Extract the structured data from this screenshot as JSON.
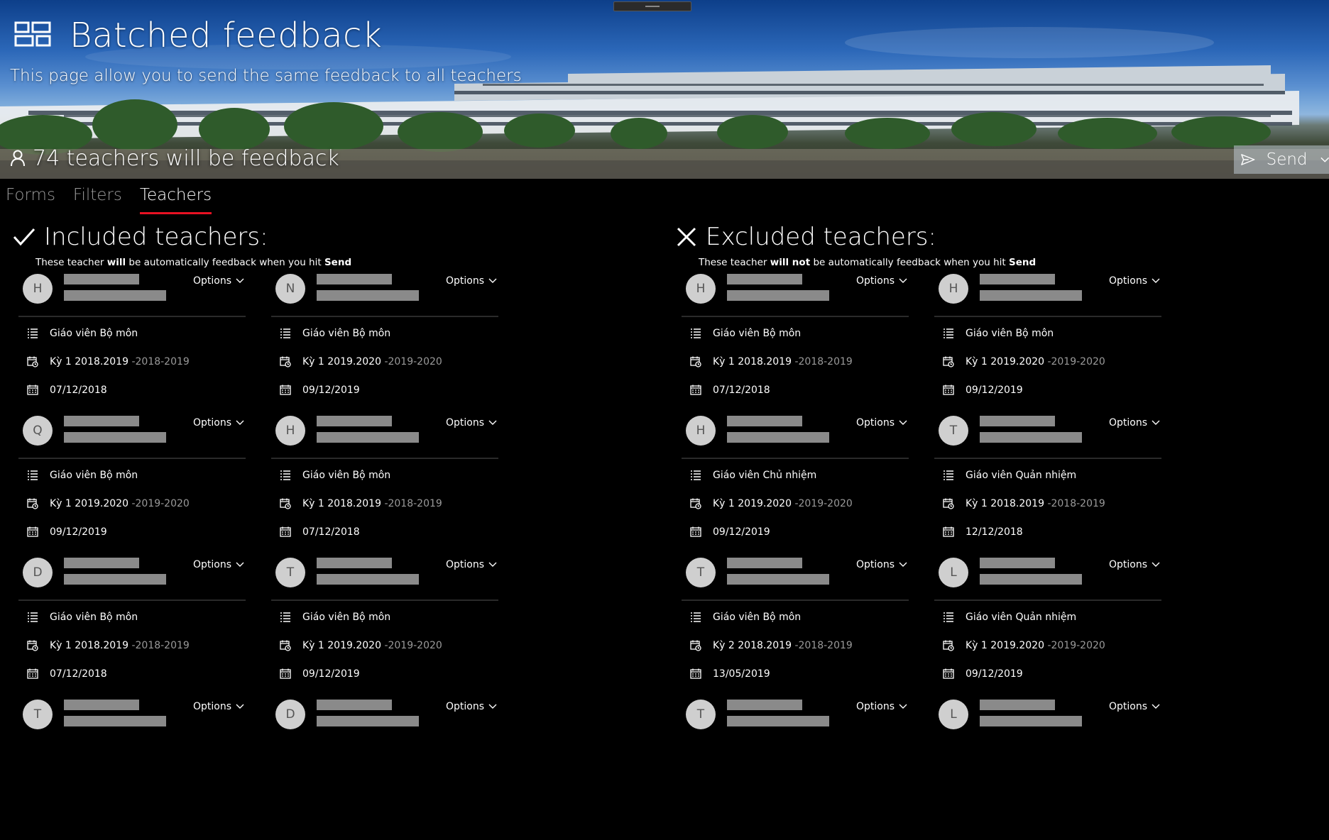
{
  "header": {
    "title": "Batched feedback",
    "subtitle": "This page allow you to send the same feedback to all teachers",
    "count_text": "74 teachers will be feedback",
    "send_label": "Send"
  },
  "tabs": [
    {
      "label": "Forms"
    },
    {
      "label": "Filters"
    },
    {
      "label": "Teachers"
    }
  ],
  "included": {
    "title": "Included teachers:",
    "desc_pre": "These teacher ",
    "desc_bold": "will",
    "desc_mid": " be automatically feedback when you hit ",
    "desc_end": "Send",
    "cards": [
      {
        "initial": "H",
        "options": "Options",
        "role": "Giáo viên Bộ môn",
        "term": "Kỳ 1 2018.2019",
        "year": "-2018-2019",
        "date": "07/12/2018"
      },
      {
        "initial": "N",
        "options": "Options",
        "role": "Giáo viên Bộ môn",
        "term": "Kỳ 1 2019.2020",
        "year": "-2019-2020",
        "date": "09/12/2019"
      },
      {
        "initial": "Q",
        "options": "Options",
        "role": "Giáo viên Bộ môn",
        "term": "Kỳ 1 2019.2020",
        "year": "-2019-2020",
        "date": "09/12/2019"
      },
      {
        "initial": "H",
        "options": "Options",
        "role": "Giáo viên Bộ môn",
        "term": "Kỳ 1 2018.2019",
        "year": "-2018-2019",
        "date": "07/12/2018"
      },
      {
        "initial": "D",
        "options": "Options",
        "role": "Giáo viên Bộ môn",
        "term": "Kỳ 1 2018.2019",
        "year": "-2018-2019",
        "date": "07/12/2018"
      },
      {
        "initial": "T",
        "options": "Options",
        "role": "Giáo viên Bộ môn",
        "term": "Kỳ 1 2019.2020",
        "year": "-2019-2020",
        "date": "09/12/2019"
      },
      {
        "initial": "T",
        "options": "Options"
      },
      {
        "initial": "D",
        "options": "Options"
      }
    ]
  },
  "excluded": {
    "title": "Excluded teachers:",
    "desc_pre": "These teacher ",
    "desc_bold": "will not",
    "desc_mid": " be automatically feedback when you hit ",
    "desc_end": "Send",
    "cards": [
      {
        "initial": "H",
        "options": "Options",
        "role": "Giáo viên Bộ môn",
        "term": "Kỳ 1 2018.2019",
        "year": "-2018-2019",
        "date": "07/12/2018"
      },
      {
        "initial": "H",
        "options": "Options",
        "role": "Giáo viên Bộ môn",
        "term": "Kỳ 1 2019.2020",
        "year": "-2019-2020",
        "date": "09/12/2019"
      },
      {
        "initial": "H",
        "options": "Options",
        "role": "Giáo viên Chủ nhiệm",
        "term": "Kỳ 1 2019.2020",
        "year": "-2019-2020",
        "date": "09/12/2019"
      },
      {
        "initial": "T",
        "options": "Options",
        "role": "Giáo viên Quản nhiệm",
        "term": "Kỳ 1 2018.2019",
        "year": "-2018-2019",
        "date": "12/12/2018"
      },
      {
        "initial": "T",
        "options": "Options",
        "role": "Giáo viên Bộ môn",
        "term": "Kỳ 2 2018.2019",
        "year": "-2018-2019",
        "date": "13/05/2019"
      },
      {
        "initial": "L",
        "options": "Options",
        "role": "Giáo viên Quản nhiệm",
        "term": "Kỳ 1 2019.2020",
        "year": "-2019-2020",
        "date": "09/12/2019"
      },
      {
        "initial": "T",
        "options": "Options"
      },
      {
        "initial": "L",
        "options": "Options"
      }
    ]
  }
}
